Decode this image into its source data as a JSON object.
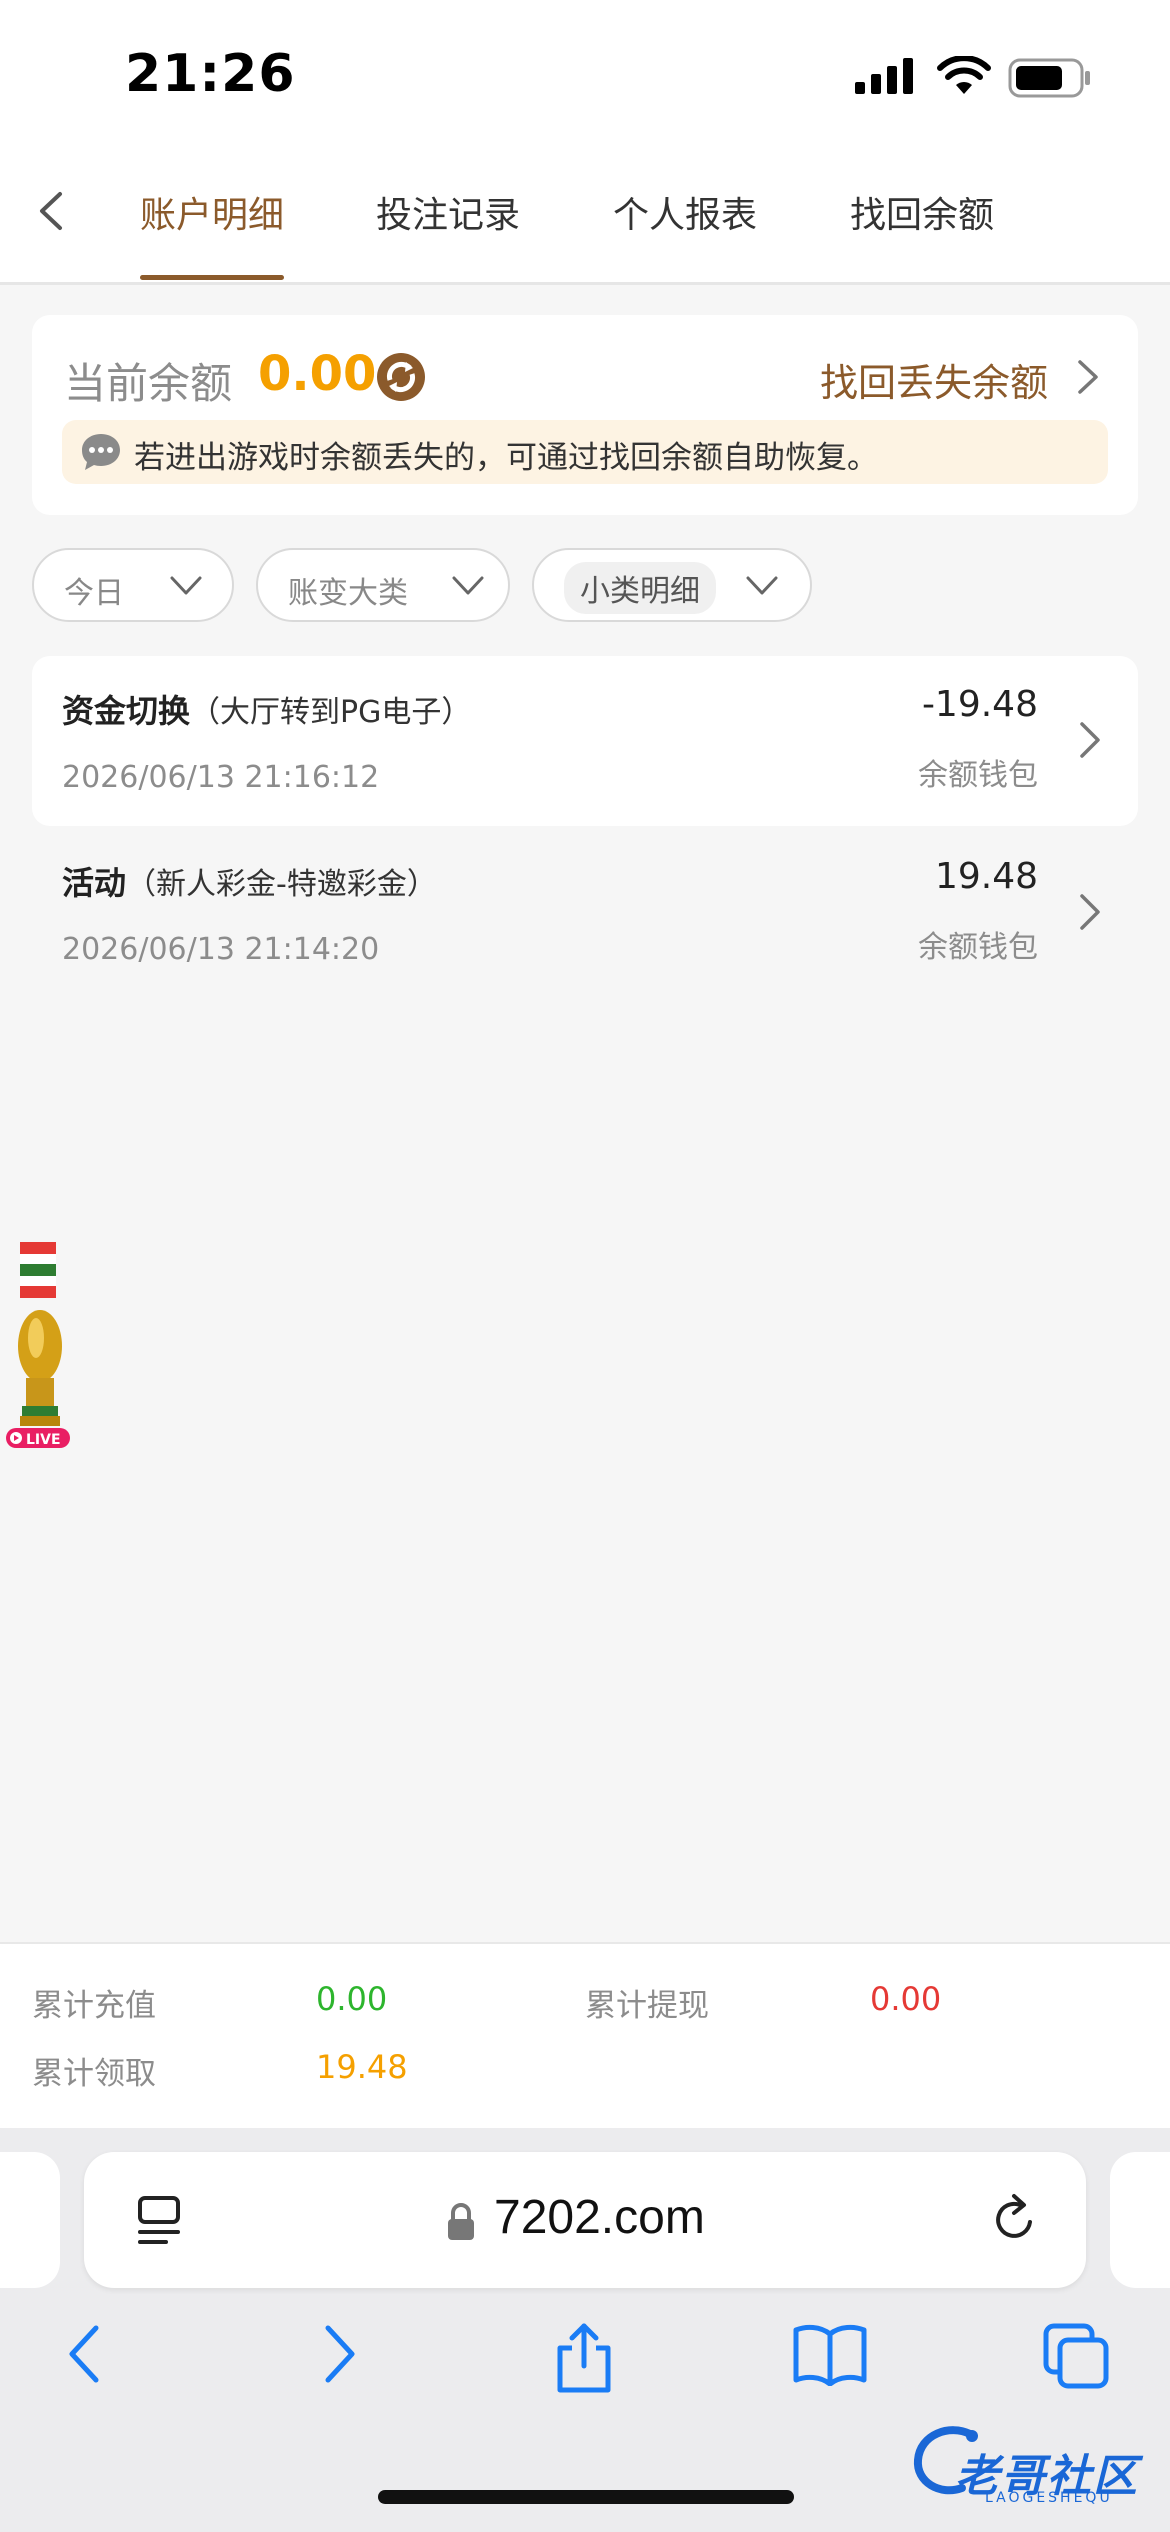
{
  "status_bar": {
    "time": "21:26"
  },
  "nav": {
    "tabs": [
      {
        "label": "账户明细",
        "active": true
      },
      {
        "label": "投注记录"
      },
      {
        "label": "个人报表"
      },
      {
        "label": "找回余额"
      }
    ]
  },
  "balance": {
    "label": "当前余额",
    "value": "0.00",
    "recover_link": "找回丢失余额",
    "tip": "若进出游戏时余额丢失的，可通过找回余额自助恢复。"
  },
  "filters": [
    {
      "label": "今日"
    },
    {
      "label": "账变大类"
    },
    {
      "label": "小类明细"
    }
  ],
  "transactions": [
    {
      "title": "资金切换",
      "subtitle": "（大厅转到PG电子）",
      "date": "2026/06/13 21:16:12",
      "amount": "-19.48",
      "wallet": "余额钱包"
    },
    {
      "title": "活动",
      "subtitle": "（新人彩金-特邀彩金）",
      "date": "2026/06/13 21:14:20",
      "amount": "19.48",
      "wallet": "余额钱包"
    }
  ],
  "floating_widget": {
    "badge": "LIVE"
  },
  "summary": {
    "deposit_label": "累计充值",
    "deposit_value": "0.00",
    "withdraw_label": "累计提现",
    "withdraw_value": "0.00",
    "claimed_label": "累计领取",
    "claimed_value": "19.48"
  },
  "browser": {
    "url": "7202.com"
  },
  "watermark": {
    "text": "老哥社区",
    "sub": "LAOGESHEQU"
  },
  "colors": {
    "accent": "#8b5a2b",
    "balance": "#f5a000",
    "positive": "#2db52d",
    "negative": "#e53935",
    "claimed": "#f5a000"
  }
}
